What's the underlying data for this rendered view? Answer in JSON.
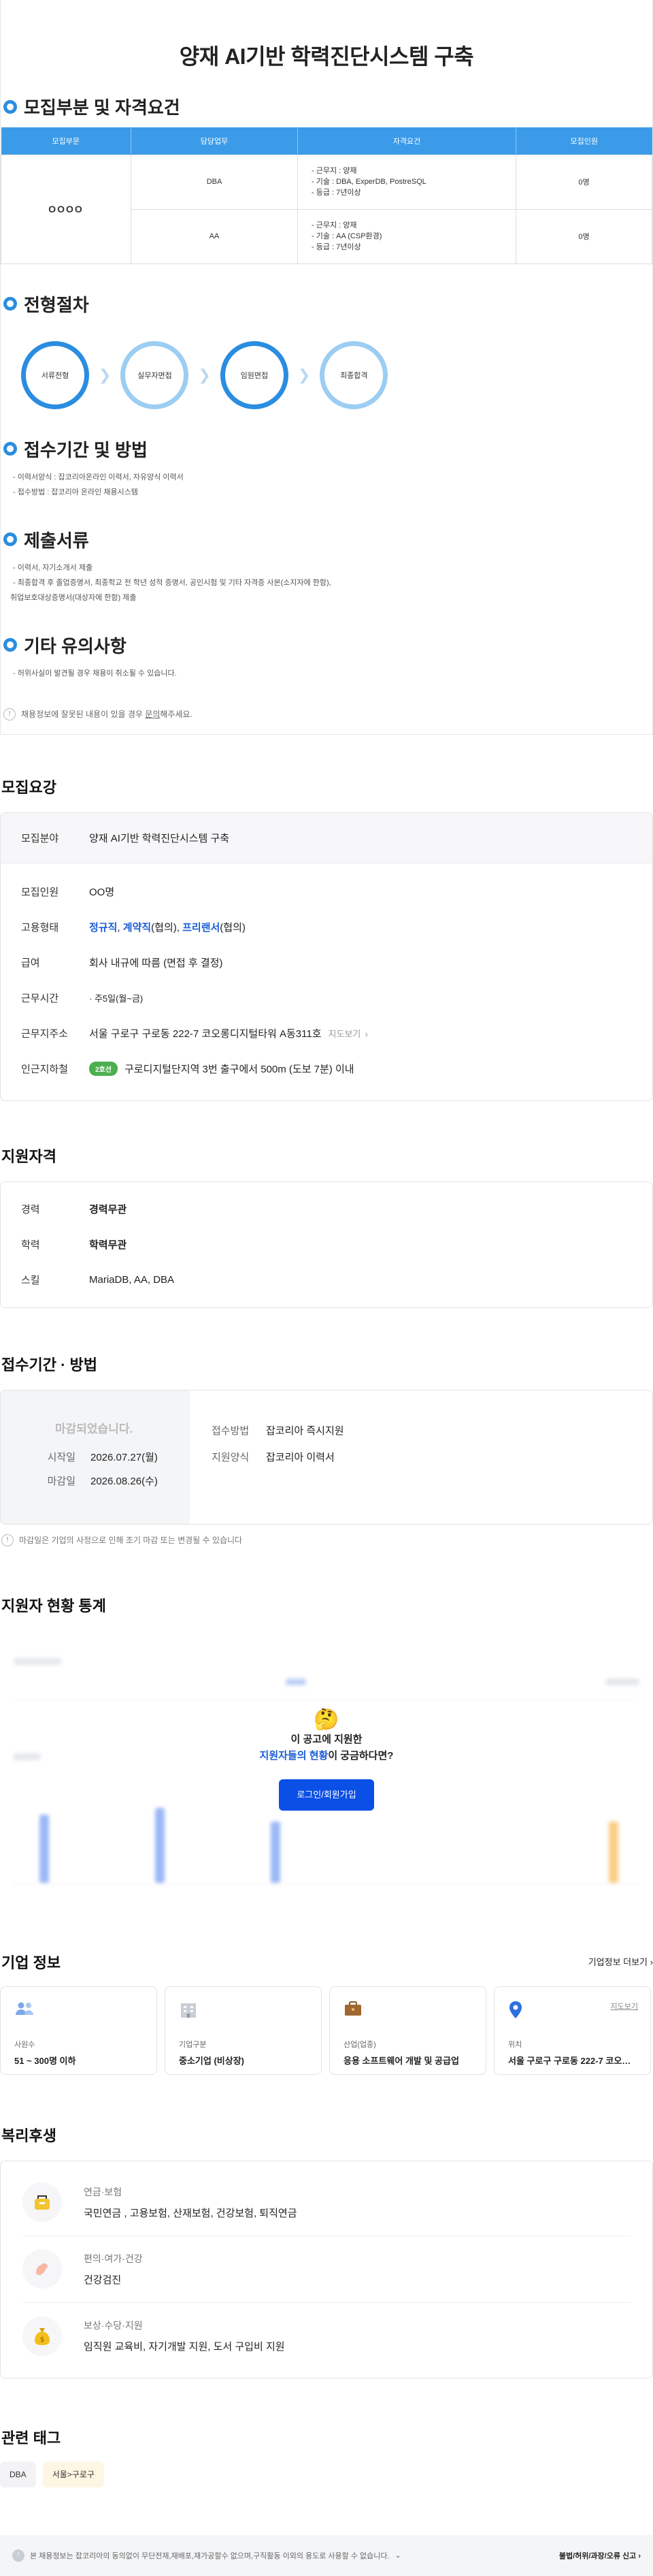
{
  "poster": {
    "title": "양재 AI기반 학력진단시스템 구축",
    "recruit_section": "모집부분 및 자격요건",
    "table_headers": [
      "모집부문",
      "담당업무",
      "자격요건",
      "모집인원"
    ],
    "field": "OOOO",
    "rows": [
      {
        "duty": "DBA",
        "req": [
          "- 근무지 : 양재",
          "- 기술 : DBA, ExperDB, PostreSQL",
          "- 등급 : 7년이상"
        ],
        "count": "0명"
      },
      {
        "duty": "AA",
        "req": [
          "- 근무지 : 양재",
          "- 기술 : AA (CSP환경)",
          "- 등급 : 7년이상"
        ],
        "count": "0명"
      }
    ],
    "process_section": "전형절차",
    "steps": [
      "서류전형",
      "실무자면접",
      "임원면접",
      "최종합격"
    ],
    "period_section": "접수기간 및 방법",
    "period_lines": [
      "- 이력서양식 : 잡코리아온라인 이력서, 자유양식 이력서",
      "- 접수방법 : 잡코리아 온라인 채용시스템"
    ],
    "docs_section": "제출서류",
    "docs_lines": [
      "- 이력서, 자기소개서 제출",
      "- 최종합격 후 졸업증명서, 최종학교 전 학년 성적 증명서, 공인시험 및 기타 자격증 사본(소지자에 한함),",
      "취업보호대상증명서(대상자에 한함) 제출"
    ],
    "etc_section": "기타 유의사항",
    "etc_lines": [
      "- 허위사실이 발견될 경우 채용이 취소될 수 있습니다."
    ],
    "report_text": "채용정보에 잘못된 내용이 있을 경우 ",
    "report_link": "문의",
    "report_tail": "해주세요."
  },
  "summary": {
    "title": "모집요강",
    "field_label": "모집분야",
    "field_value": "양재 AI기반 학력진단시스템 구축",
    "headcount_label": "모집인원",
    "headcount_value": "OO명",
    "employment_label": "고용형태",
    "employment_1": "정규직",
    "employment_sep1": ", ",
    "employment_2": "계약직",
    "employment_sep2": "(협의), ",
    "employment_3": "프리랜서",
    "employment_tail": "(협의)",
    "salary_label": "급여",
    "salary_value": "회사 내규에 따름 (면접 후 결정)",
    "hours_label": "근무시간",
    "hours_value": "· 주5일(월~금)",
    "address_label": "근무지주소",
    "address_value": "서울 구로구 구로동 222-7 코오롱디지털타워 A동311호",
    "map_link": "지도보기",
    "subway_label": "인근지하철",
    "subway_line": "2호선",
    "subway_value": "구로디지털단지역 3번 출구에서 500m (도보 7분) 이내"
  },
  "qualification": {
    "title": "지원자격",
    "career_label": "경력",
    "career_value": "경력무관",
    "edu_label": "학력",
    "edu_value": "학력무관",
    "skill_label": "스킬",
    "skill_value": "MariaDB, AA, DBA"
  },
  "period": {
    "title": "접수기간 · 방법",
    "closed": "마감되었습니다.",
    "start_label": "시작일",
    "start_value": "2026.07.27(월)",
    "end_label": "마감일",
    "end_value": "2026.08.26(수)",
    "method_label": "접수방법",
    "method_value": "잡코리아 즉시지원",
    "form_label": "지원양식",
    "form_value": "잡코리아 이력서",
    "note": "마감일은 기업의 사정으로 인해 조기 마감 또는 변경될 수 있습니다"
  },
  "stats": {
    "title": "지원자 현황 통계",
    "line1": "이 공고에 지원한",
    "line2_hl": "지원자들의 현황",
    "line2_tail": "이 궁금하다면?",
    "login": "로그인/회원가입"
  },
  "company": {
    "title": "기업 정보",
    "more": "기업정보 더보기",
    "cards": [
      {
        "label": "사원수",
        "value": "51 ~ 300명 이하",
        "icon": "people-icon"
      },
      {
        "label": "기업구분",
        "value": "중소기업 (비상장)",
        "icon": "building-icon"
      },
      {
        "label": "산업(업종)",
        "value": "응용 소프트웨어 개발 및 공급업",
        "icon": "briefcase-icon"
      },
      {
        "label": "위치",
        "value": "서울 구로구 구로동 222-7 코오롱디지털타워",
        "icon": "map-pin-icon"
      }
    ],
    "map_link": "지도보기"
  },
  "welfare": {
    "title": "복리후생",
    "items": [
      {
        "category": "연금·보험",
        "items": "국민연금 , 고용보험, 산재보험, 건강보험, 퇴직연금",
        "icon": "pension-icon"
      },
      {
        "category": "편의·여가·건강",
        "items": "건강검진",
        "icon": "health-icon"
      },
      {
        "category": "보상·수당·지원",
        "items": "임직원 교육비, 자기개발 지원, 도서 구입비 지원",
        "icon": "money-bag-icon"
      }
    ]
  },
  "tags": {
    "title": "관련 태그",
    "items": [
      "DBA",
      "서울>구로구"
    ]
  },
  "footer": {
    "notice": "본 채용정보는 잡코리아의 동의없이 무단전재,재배포,재가공할수 없으며,구직활동 이외의 용도로 사용할 수 없습니다.",
    "report": "불법/허위/과장/오류 신고"
  },
  "colors": {
    "accent": "#2a8de0",
    "link_blue": "#1a5dd6",
    "login_button": "#0a4fe6",
    "subway_green": "#4caf50"
  }
}
